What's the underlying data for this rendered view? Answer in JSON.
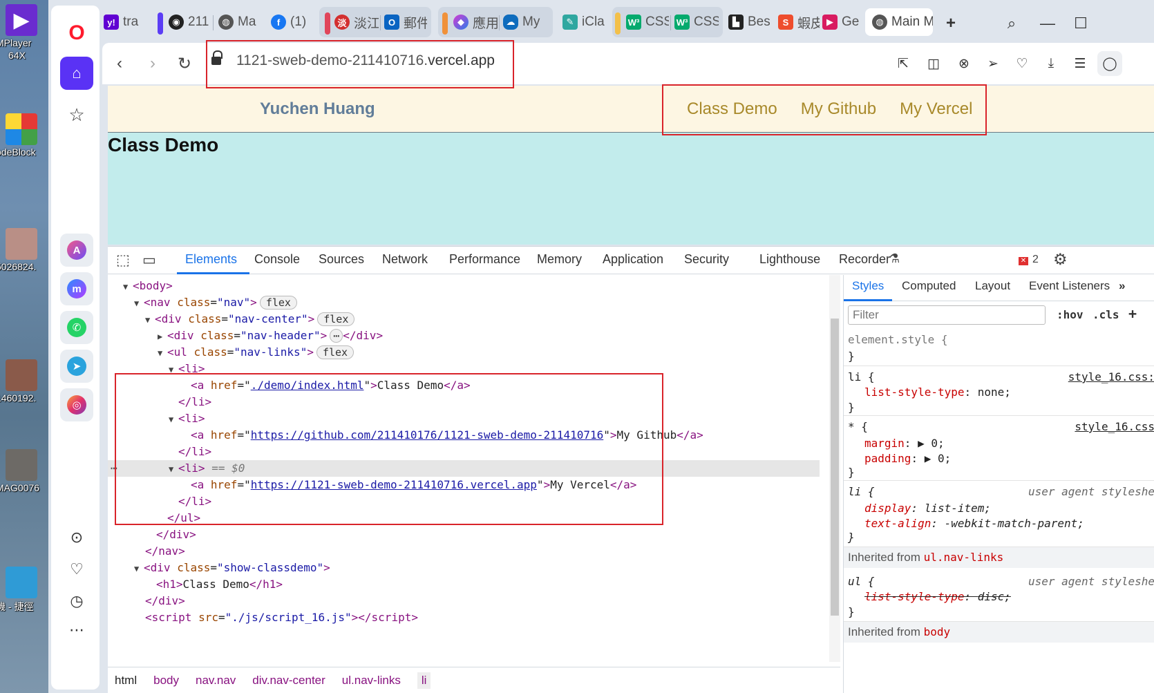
{
  "desktop": {
    "icons": [
      {
        "label": "MPlayer",
        "label2": "64X"
      },
      {
        "label": "odeBlock"
      },
      {
        "label": "5026824."
      },
      {
        "label": "1460192."
      },
      {
        "label": "MAG0076"
      },
      {
        "label": "機 - 捷徑"
      }
    ]
  },
  "tabs": [
    {
      "label": "tra",
      "icon": "yahoo-icon"
    },
    {
      "label": "211",
      "icon": "github-icon"
    },
    {
      "label": "Ma",
      "icon": "globe-icon"
    },
    {
      "label": "(1)",
      "icon": "facebook-icon"
    },
    {
      "label": "淡江",
      "icon": "tku-icon"
    },
    {
      "label": "郵件",
      "icon": "outlook-icon"
    },
    {
      "label": "應用",
      "icon": "m365-icon"
    },
    {
      "label": "My",
      "icon": "onedrive-icon"
    },
    {
      "label": "iCla",
      "icon": "icla-icon"
    },
    {
      "label": "CSS",
      "icon": "w3schools-icon"
    },
    {
      "label": "CSS",
      "icon": "w3schools-icon"
    },
    {
      "label": "Bes",
      "icon": "bes-icon"
    },
    {
      "label": "蝦皮",
      "icon": "shopee-icon"
    },
    {
      "label": "Ge",
      "icon": "gemini-icon"
    },
    {
      "label": "Main M",
      "icon": "globe-icon"
    }
  ],
  "address": {
    "url_path": "1121-sweb-demo-211410716.",
    "url_host": "vercel.app"
  },
  "site": {
    "brand": "Yuchen Huang",
    "links": [
      "Class Demo",
      "My Github",
      "My Vercel"
    ],
    "heading": "Class Demo"
  },
  "devtools": {
    "tabs": [
      "Elements",
      "Console",
      "Sources",
      "Network",
      "Performance",
      "Memory",
      "Application",
      "Security",
      "Lighthouse",
      "Recorder"
    ],
    "error_count": "2",
    "code": {
      "body": "body",
      "nav_tag": "nav",
      "nav_class": "\"nav\"",
      "flex": "flex",
      "div_tag": "div",
      "nav_center": "\"nav-center\"",
      "nav_header": "\"nav-header\"",
      "ul_tag": "ul",
      "nav_links": "\"nav-links\"",
      "li_tag": "li",
      "href1": "./demo/index.html",
      "text1": "Class Demo",
      "href2": "https://github.com/211410176/1121-sweb-demo-211410716",
      "text2": "My Github",
      "href3": "https://1121-sweb-demo-211410716.vercel.app",
      "text3": "My Vercel",
      "selected_marker": "== $0",
      "show_classdemo": "\"show-classdemo\"",
      "h1_text": "Class Demo",
      "script_src": "\"./js/script_16.js\""
    },
    "breadcrumbs": [
      "html",
      "body",
      "nav.nav",
      "div.nav-center",
      "ul.nav-links",
      "li"
    ],
    "styles": {
      "tabs": [
        "Styles",
        "Computed",
        "Layout",
        "Event Listeners"
      ],
      "filter_placeholder": "Filter",
      "hov": ":hov",
      "cls": ".cls",
      "element_style": "element.style {",
      "rule1_selector": "li {",
      "rule1_source": "style_16.css:",
      "rule1_prop": "list-style-type",
      "rule1_value": "none;",
      "rule2_selector": "* {",
      "rule2_source": "style_16.css",
      "rule2_prop1": "margin",
      "rule2_val1": "0;",
      "rule2_prop2": "padding",
      "rule2_val2": "0;",
      "rule3_selector": "li {",
      "rule3_source": "user agent styleshe",
      "rule3_prop1": "display",
      "rule3_val1": "list-item;",
      "rule3_prop2": "text-align",
      "rule3_val2": "-webkit-match-parent;",
      "inherited1_label": "Inherited from",
      "inherited1_sel": "ul.nav-links",
      "rule4_selector": "ul {",
      "rule4_source": "user agent styleshe",
      "rule4_prop": "list-style-type",
      "rule4_val": "disc;",
      "inherited2_label": "Inherited from",
      "inherited2_sel": "body"
    }
  }
}
